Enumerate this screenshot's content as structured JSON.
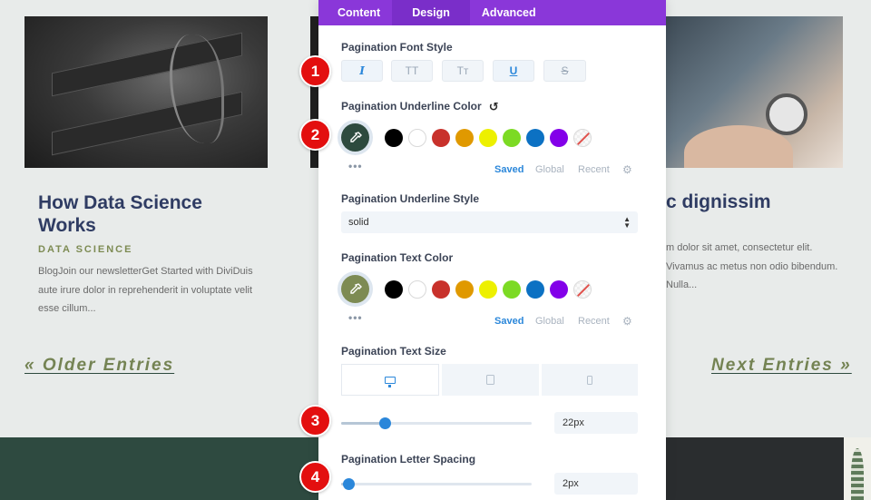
{
  "panel": {
    "tabs": [
      "Content",
      "Design",
      "Advanced"
    ],
    "font_style": {
      "label": "Pagination Font Style",
      "options": [
        "I",
        "TT",
        "Tт",
        "U",
        "S"
      ]
    },
    "underline_color": {
      "label": "Pagination Underline Color",
      "selected": "#2d4a3e"
    },
    "underline_style": {
      "label": "Pagination Underline Style",
      "value": "solid"
    },
    "text_color": {
      "label": "Pagination Text Color",
      "selected": "#7d8b53"
    },
    "palette": {
      "dots": "•••",
      "colors": [
        "#000000",
        "#ffffff",
        "#c8312b",
        "#e09900",
        "#edf000",
        "#7cda24",
        "#0c71c3",
        "#8300e9"
      ],
      "tabs": [
        "Saved",
        "Global",
        "Recent"
      ]
    },
    "text_size": {
      "label": "Pagination Text Size",
      "value": "22px",
      "level": 0.23
    },
    "letter_spacing": {
      "label": "Pagination Letter Spacing",
      "value": "2px",
      "level": 0.04
    }
  },
  "badges": [
    "1",
    "2",
    "3",
    "4"
  ],
  "page": {
    "post1": {
      "title": "How Data Science Works",
      "category": "DATA SCIENCE",
      "excerpt": "BlogJoin our newsletterGet Started with DiviDuis aute irure dolor in reprehenderit in voluptate velit esse cillum..."
    },
    "post2": {
      "title": "c dignissim",
      "excerpt": "m dolor sit amet, consectetur elit. Vivamus ac metus non odio bibendum. Nulla..."
    },
    "older_entries": "« Older Entries",
    "next_entries": "Next Entries »"
  }
}
